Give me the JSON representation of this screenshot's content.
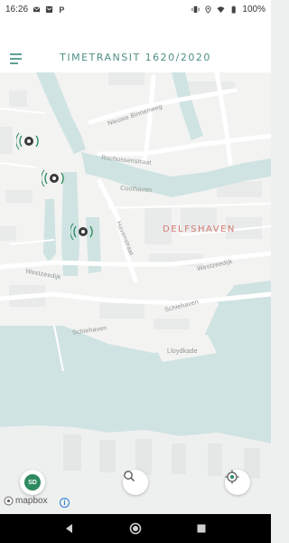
{
  "status_bar": {
    "time": "16:26",
    "battery": "100%",
    "left_icons": [
      "mail-icon",
      "email-icon",
      "parking-icon"
    ],
    "right_icons": [
      "vibrate-icon",
      "location-icon",
      "wifi-icon",
      "battery-icon"
    ]
  },
  "header": {
    "title": "TIMETRANSIT 1620/2020",
    "menu_icon": "menu-icon"
  },
  "map": {
    "district": "DELFSHAVEN",
    "streets": {
      "nieuwe_binnenweg": "Nieuwe Binnenweg",
      "rochussenstraat": "Rochussenstraat",
      "coolhaven": "Coolhaven",
      "havenstraat": "Havenstraat",
      "westzeedijk_left": "Westzeedijk",
      "westzeedijk_right": "Westzeedijk",
      "schiehaven_left": "Schiehaven",
      "schiehaven_right": "Schiehaven",
      "lloydkade": "Lloydkade"
    },
    "poi_count": 3,
    "colors": {
      "water": "#cfe3e2",
      "land": "#f3f3f2",
      "roads": "#ffffff",
      "accent": "#2e8a5f"
    }
  },
  "controls": {
    "badge_label": "SD",
    "search_icon": "search-icon",
    "locate_icon": "locate-icon",
    "attribution": "mapbox",
    "info_label": "i"
  },
  "nav": {
    "icons": [
      "back-icon",
      "home-icon",
      "recents-icon"
    ]
  }
}
